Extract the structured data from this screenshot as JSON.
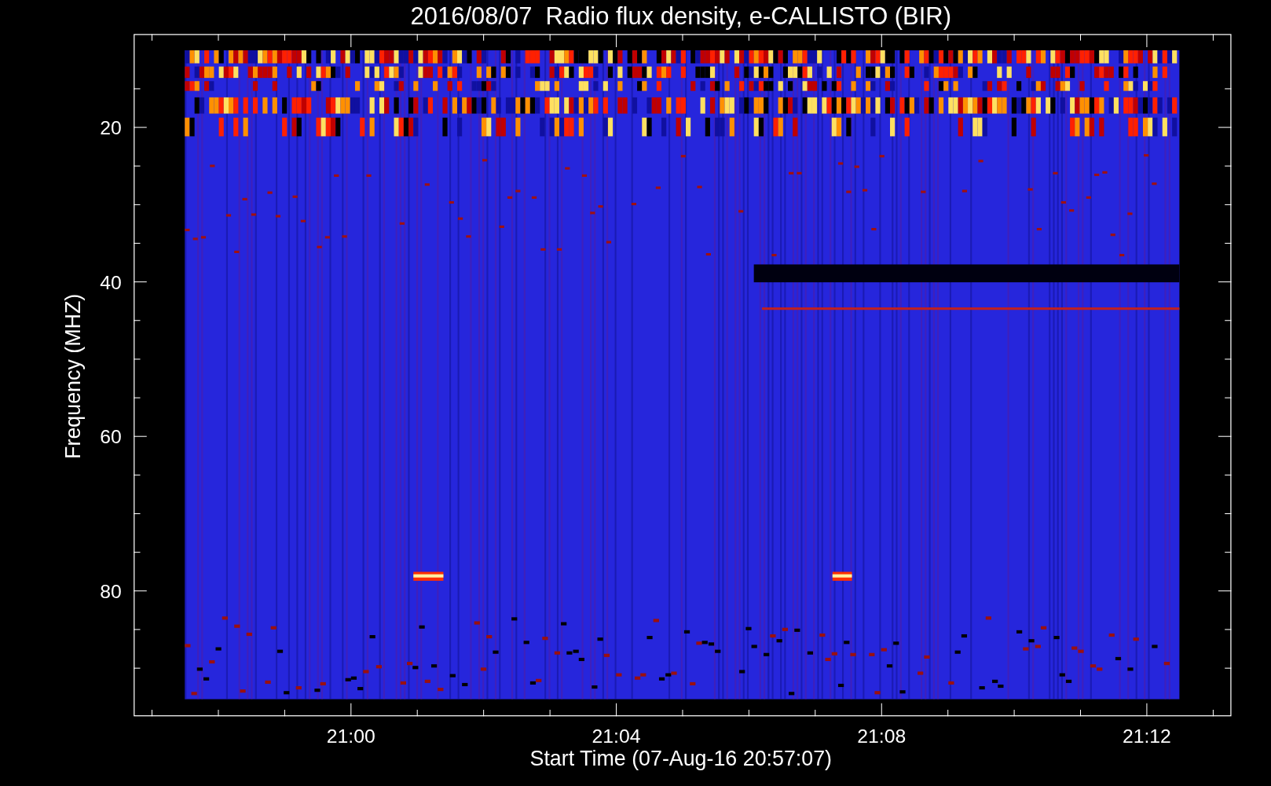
{
  "title": "2016/08/07  Radio flux density, e-CALLISTO (BIR)",
  "plot": {
    "ylabel": "Frequency (MHZ)",
    "xlabel": "Start Time (07-Aug-16 20:57:07)",
    "yticks": [
      "20",
      "40",
      "60",
      "80"
    ],
    "xticks": [
      "21:00",
      "21:04",
      "21:08",
      "21:12"
    ]
  }
}
